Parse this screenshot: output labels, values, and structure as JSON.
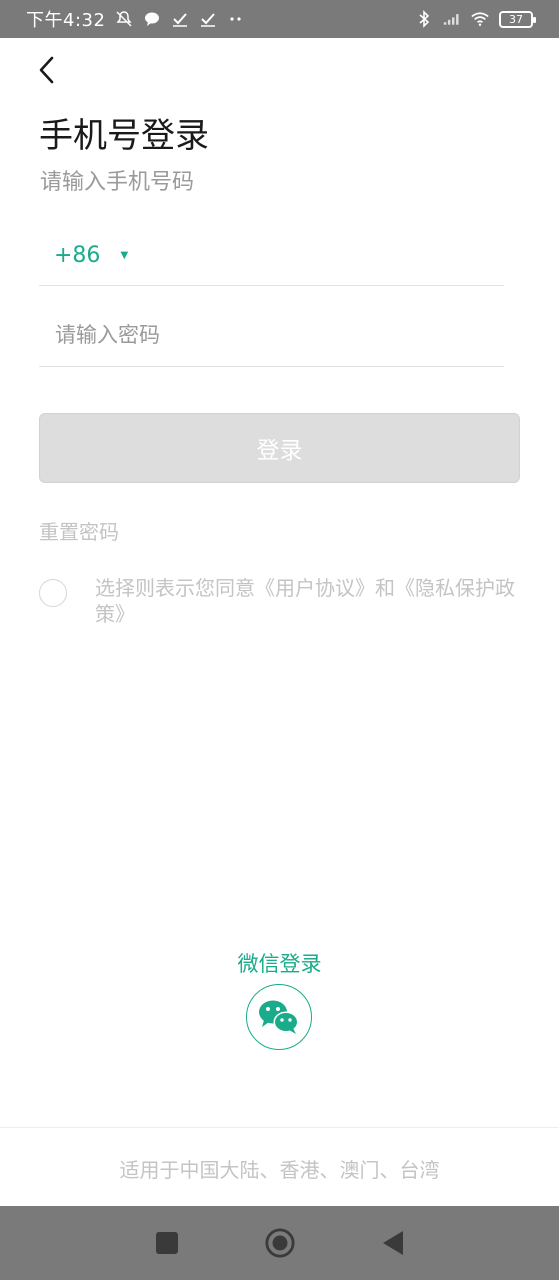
{
  "status_bar": {
    "time": "下午4:32",
    "battery": "37",
    "left_icons": [
      "mute-icon",
      "chat-bubble-icon",
      "check-icon",
      "check-icon",
      "dots-icon"
    ],
    "right_icons": [
      "bluetooth-icon",
      "signal-icon",
      "wifi-icon",
      "battery-icon"
    ]
  },
  "header": {
    "title": "手机号登录",
    "subtitle": "请输入手机号码"
  },
  "form": {
    "country_code": "+86",
    "phone_value": "",
    "password_placeholder": "请输入密码",
    "login_label": "登录",
    "reset_label": "重置密码",
    "agreement_text": "选择则表示您同意《用户协议》和《隐私保护政策》"
  },
  "wechat": {
    "label": "微信登录"
  },
  "footer": {
    "text": "适用于中国大陆、香港、澳门、台湾"
  },
  "colors": {
    "accent": "#1aab8a",
    "disabled_button": "#dddddd",
    "muted_text": "#c4c4c4",
    "system_bar": "#7a7a7a"
  }
}
